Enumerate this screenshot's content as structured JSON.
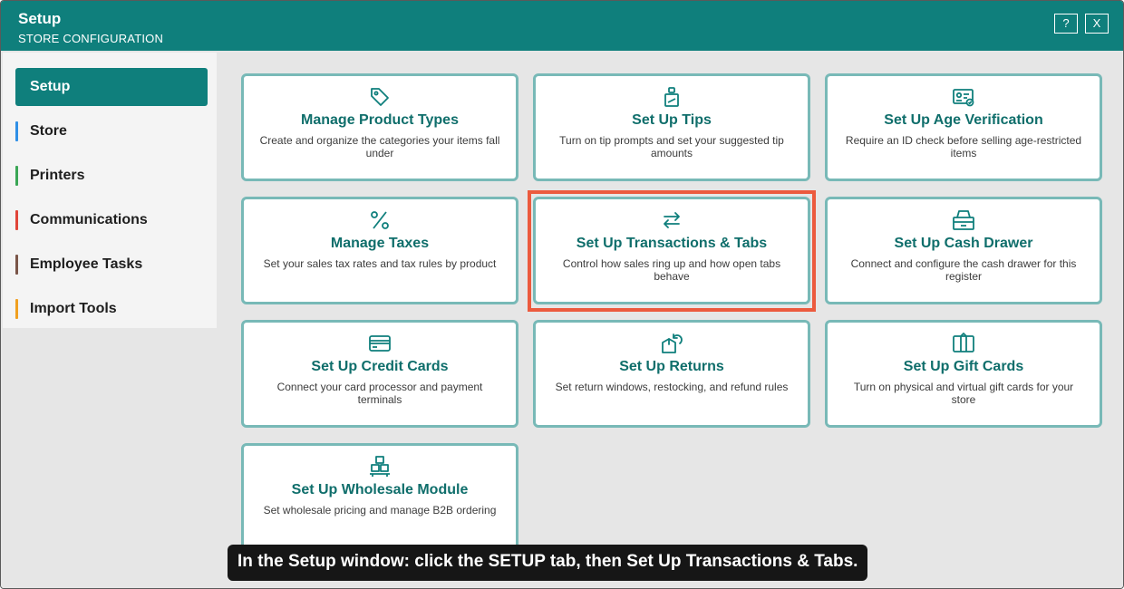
{
  "window": {
    "title": "Setup",
    "subtitle": "STORE CONFIGURATION",
    "help_label": "?",
    "close_label": "X"
  },
  "sidebar": {
    "items": [
      {
        "label": "Setup",
        "active": true
      },
      {
        "label": "Store",
        "accent": "#2f8fe6"
      },
      {
        "label": "Printers",
        "accent": "#3aa655"
      },
      {
        "label": "Communications",
        "accent": "#e0453a"
      },
      {
        "label": "Employee Tasks",
        "accent": "#7a5548"
      },
      {
        "label": "Import Tools",
        "accent": "#f0a020"
      }
    ]
  },
  "cards": [
    {
      "title": "Manage Product Types",
      "desc": "Create and organize the categories your items fall under",
      "icon": "tag-icon"
    },
    {
      "title": "Set Up Tips",
      "desc": "Turn on tip prompts and set your suggested tip amounts",
      "icon": "tip-jar-icon"
    },
    {
      "title": "Set Up Age Verification",
      "desc": "Require an ID check before selling age-restricted items",
      "icon": "id-card-icon"
    },
    {
      "title": "Manage Taxes",
      "desc": "Set your sales tax rates and tax rules by product",
      "icon": "percent-icon"
    },
    {
      "title": "Set Up Transactions & Tabs",
      "desc": "Control how sales ring up and how open tabs behave",
      "icon": "swap-arrows-icon"
    },
    {
      "title": "Set Up Cash Drawer",
      "desc": "Connect and configure the cash drawer for this register",
      "icon": "cash-drawer-icon"
    },
    {
      "title": "Set Up Credit Cards",
      "desc": "Connect your card processor and payment terminals",
      "icon": "credit-card-icon"
    },
    {
      "title": "Set Up Returns",
      "desc": "Set return windows, restocking, and refund rules",
      "icon": "return-box-icon"
    },
    {
      "title": "Set Up Gift Cards",
      "desc": "Turn on physical and virtual gift cards for your store",
      "icon": "gift-card-icon"
    },
    {
      "title": "Set Up Wholesale Module",
      "desc": "Set wholesale pricing and manage B2B ordering",
      "icon": "boxes-icon"
    }
  ],
  "caption": "In the Setup window: click the SETUP tab, then Set Up Transactions & Tabs.",
  "colors": {
    "brand": "#0f7f7c",
    "card_border": "#78b9b7",
    "highlight": "#ec5a3e"
  }
}
